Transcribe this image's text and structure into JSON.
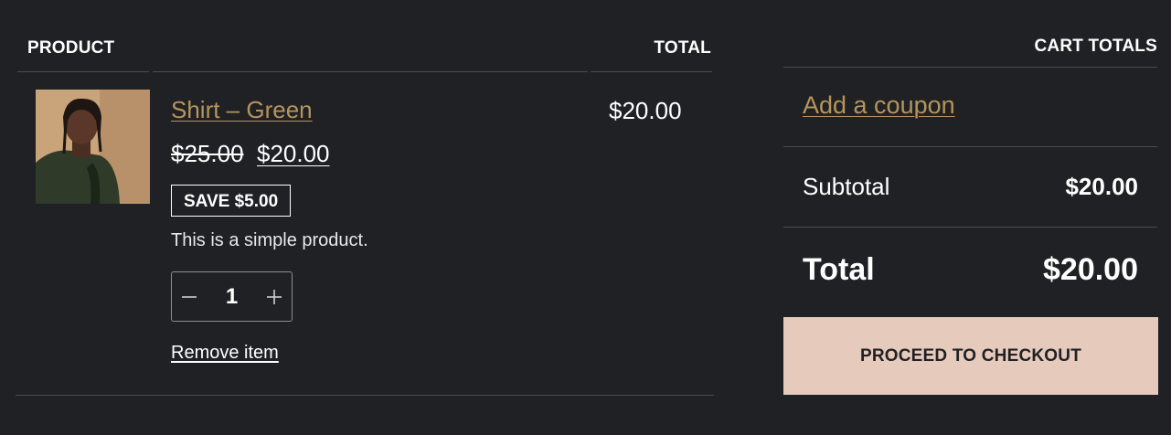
{
  "cart": {
    "headers": {
      "product": "PRODUCT",
      "total": "TOTAL"
    },
    "item": {
      "image_alt": "Shirt – Green",
      "name": "Shirt – Green",
      "regular_price": "$25.00",
      "sale_price": "$20.00",
      "save_badge": "SAVE $5.00",
      "description": "This is a simple product.",
      "quantity": "1",
      "remove_label": "Remove item",
      "line_total": "$20.00"
    }
  },
  "totals": {
    "heading": "CART TOTALS",
    "coupon_label": "Add a coupon",
    "subtotal_label": "Subtotal",
    "subtotal_value": "$20.00",
    "total_label": "Total",
    "total_value": "$20.00",
    "checkout_label": "PROCEED TO CHECKOUT"
  },
  "colors": {
    "background": "#202124",
    "link_gold": "#b5955c",
    "checkout_button": "#e6cbbd",
    "divider": "#4a4b4f"
  },
  "icons": [
    "minus-icon",
    "plus-icon"
  ]
}
